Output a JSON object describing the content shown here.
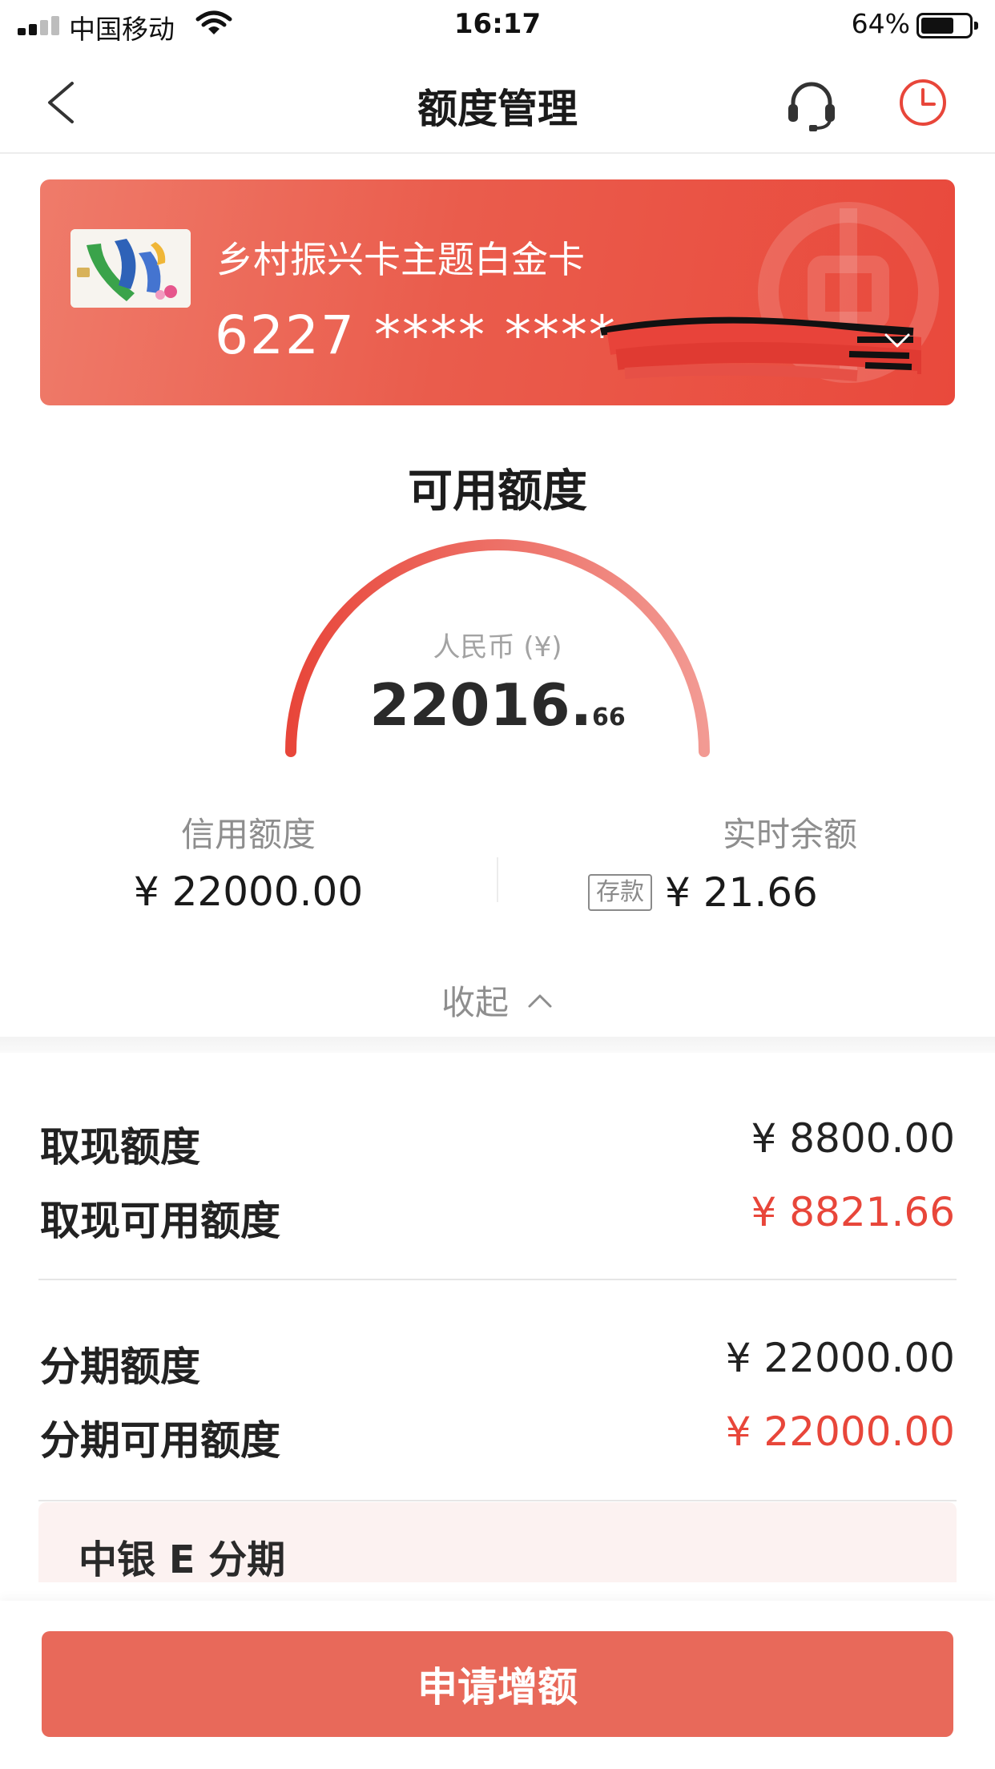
{
  "status_bar": {
    "carrier": "中国移动",
    "time": "16:17",
    "battery": "64%",
    "battery_level": 0.64
  },
  "nav": {
    "title": "额度管理",
    "icons": [
      "back-icon",
      "headset-icon",
      "history-icon"
    ]
  },
  "card": {
    "name": "乡村振兴卡主题白金卡",
    "number": "6227 **** ****"
  },
  "available": {
    "title": "可用额度",
    "currency": "人民币 (¥)",
    "amount_int": "22016.",
    "amount_dec": "66"
  },
  "credit": {
    "label": "信用额度",
    "value": "¥ 22000.00"
  },
  "balance": {
    "label": "实时余额",
    "badge": "存款",
    "value": "¥ 21.66"
  },
  "collapse": {
    "label": "收起"
  },
  "cash": {
    "limit_label": "取现额度",
    "limit_value": "¥ 8800.00",
    "available_label": "取现可用额度",
    "available_value": "¥ 8821.66"
  },
  "installment": {
    "limit_label": "分期额度",
    "limit_value": "¥ 22000.00",
    "available_label": "分期可用额度",
    "available_value": "¥ 22000.00",
    "e_title": "中银 E 分期"
  },
  "footer": {
    "apply_label": "申请增额"
  },
  "colors": {
    "accent_red": "#e8463a",
    "card_red": "#ea5c4c",
    "button_red": "#e8695a"
  }
}
